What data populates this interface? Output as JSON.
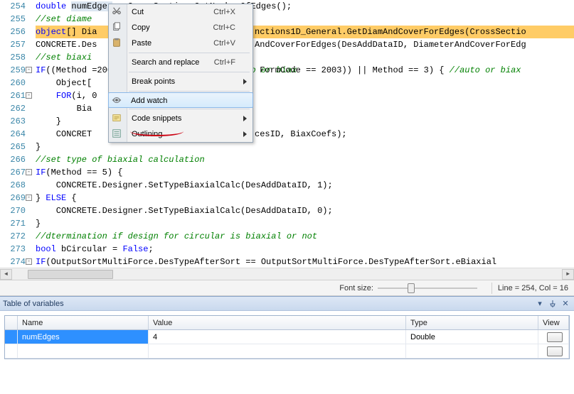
{
  "editor": {
    "lines": [
      {
        "num": "254",
        "tok": [
          [
            "typ",
            "double"
          ],
          [
            "pln",
            " "
          ],
          [
            "sel",
            "numEdges"
          ],
          [
            "pln",
            " = CrossSection.GetNumberOfEdges();"
          ]
        ]
      },
      {
        "num": "255",
        "tok": [
          [
            "cmt",
            "//set diame"
          ]
        ]
      },
      {
        "num": "256",
        "hl": true,
        "tok": [
          [
            "typ",
            "object"
          ],
          [
            "pln",
            "[] Dia"
          ],
          [
            "tail",
            "nctions1D_General.GetDiamAndCoverForEdges(CrossSectio"
          ]
        ]
      },
      {
        "num": "257",
        "tok": [
          [
            "pln",
            "CONCRETE.Des"
          ],
          [
            "tail",
            "AndCoverForEdges(DesAddDataID, DiameterAndCoverForEdg"
          ]
        ]
      },
      {
        "num": "258",
        "tok": [
          [
            "cmt",
            "//set biaxi"
          ]
        ]
      },
      {
        "num": "259",
        "fold": "-",
        "tok": [
          [
            "kw",
            "IF"
          ],
          [
            "pln",
            "((Method ="
          ],
          [
            "tail",
            " FormCode == "
          ],
          [
            "num",
            "2003"
          ],
          [
            "pln",
            ")) || Method == "
          ],
          [
            "num",
            "3"
          ],
          [
            "pln",
            ") { "
          ],
          [
            "cmt",
            "//auto or biax"
          ]
        ]
      },
      {
        "num": "260",
        "tok": [
          [
            "pln",
            "    Object["
          ]
        ]
      },
      {
        "num": "261",
        "fold": "-",
        "tok": [
          [
            "pln",
            "    "
          ],
          [
            "kw",
            "FOR"
          ],
          [
            "pln",
            "(i, "
          ],
          [
            "num",
            "0"
          ]
        ]
      },
      {
        "num": "262",
        "tok": [
          [
            "pln",
            "        Bia"
          ]
        ]
      },
      {
        "num": "263",
        "tok": [
          [
            "pln",
            "    }"
          ]
        ]
      },
      {
        "num": "264",
        "tok": [
          [
            "pln",
            "    CONCRET"
          ],
          [
            "tail",
            "cesID, BiaxCoefs);"
          ]
        ]
      },
      {
        "num": "265",
        "tok": [
          [
            "pln",
            "}"
          ]
        ]
      },
      {
        "num": "266",
        "tok": [
          [
            "cmt",
            "//set type of biaxial calculation"
          ]
        ]
      },
      {
        "num": "267",
        "fold": "-",
        "tok": [
          [
            "kw",
            "IF"
          ],
          [
            "pln",
            "(Method == "
          ],
          [
            "num",
            "5"
          ],
          [
            "pln",
            ") {"
          ]
        ]
      },
      {
        "num": "268",
        "tok": [
          [
            "pln",
            "    CONCRETE.Designer.SetTypeBiaxialCalc(DesAddDataID, "
          ],
          [
            "num",
            "1"
          ],
          [
            "pln",
            ");"
          ]
        ]
      },
      {
        "num": "269",
        "fold": "-",
        "tok": [
          [
            "pln",
            "} "
          ],
          [
            "kw",
            "ELSE"
          ],
          [
            "pln",
            " {"
          ]
        ]
      },
      {
        "num": "270",
        "tok": [
          [
            "pln",
            "    CONCRETE.Designer.SetTypeBiaxialCalc(DesAddDataID, "
          ],
          [
            "num",
            "0"
          ],
          [
            "pln",
            ");"
          ]
        ]
      },
      {
        "num": "271",
        "tok": [
          [
            "pln",
            "}"
          ]
        ]
      },
      {
        "num": "272",
        "tok": [
          [
            "cmt",
            "//dtermination if design for circular is biaxial or not"
          ]
        ]
      },
      {
        "num": "273",
        "tok": [
          [
            "typ",
            "bool"
          ],
          [
            "pln",
            " bCircular = "
          ],
          [
            "kw",
            "False"
          ],
          [
            "pln",
            ";"
          ]
        ]
      },
      {
        "num": "274",
        "fold": "-",
        "tok": [
          [
            "kw",
            "IF"
          ],
          [
            "pln",
            "(OutputSortMultiForce.DesTypeAfterSort == OutputSortMultiForce.DesTypeAfterSort.eBiaxial"
          ]
        ]
      }
    ]
  },
  "context_menu": {
    "items": [
      {
        "label": "Cut",
        "shortcut": "Ctrl+X",
        "icon": "cut-icon"
      },
      {
        "label": "Copy",
        "shortcut": "Ctrl+C",
        "icon": "copy-icon"
      },
      {
        "label": "Paste",
        "shortcut": "Ctrl+V",
        "icon": "paste-icon"
      },
      {
        "sep": true
      },
      {
        "label": "Search and replace",
        "shortcut": "Ctrl+F"
      },
      {
        "sep": true
      },
      {
        "label": "Break points",
        "submenu": true
      },
      {
        "sep": true
      },
      {
        "label": "Add watch",
        "icon": "watch-icon",
        "highlight": true
      },
      {
        "sep": true
      },
      {
        "label": "Code snippets",
        "submenu": true,
        "icon": "snippet-icon"
      },
      {
        "label": "Outlining",
        "submenu": true,
        "icon": "outline-icon"
      }
    ]
  },
  "statusbar": {
    "font_size_label": "Font size:",
    "linecol": "Line = 254, Col = 16"
  },
  "panel": {
    "title": "Table of variables",
    "columns": {
      "name": "Name",
      "value": "Value",
      "type": "Type",
      "view": "View"
    },
    "rows": [
      {
        "name": "numEdges",
        "value": "4",
        "type": "Double"
      }
    ]
  }
}
